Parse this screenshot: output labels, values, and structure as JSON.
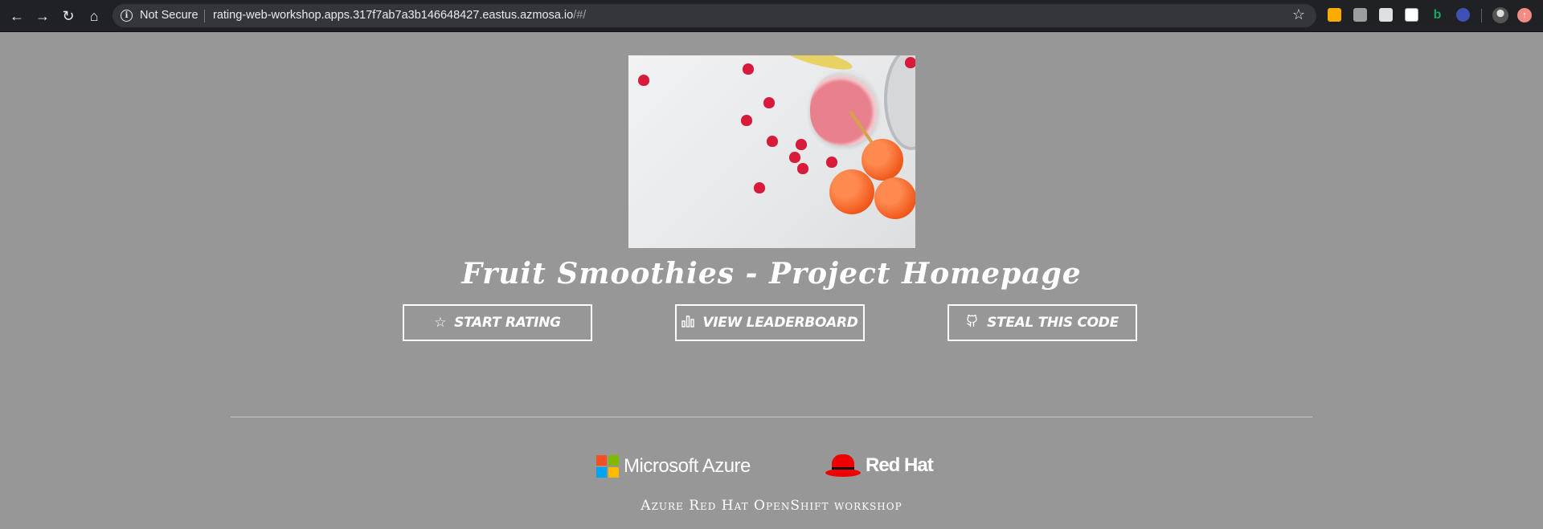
{
  "browser": {
    "security_label": "Not Secure",
    "url_host": "rating-web-workshop.apps.317f7ab7a3b146648427.eastus.azmosa.io",
    "url_path": "/#/",
    "extension_colors": [
      "#f9ab00",
      "#9e9e9e",
      "#ffffff",
      "#ffffff",
      "#1da462",
      "#3f51b5"
    ]
  },
  "page": {
    "title": "Fruit Smoothies - Project Homepage",
    "buttons": {
      "start_rating": {
        "label": "Start Rating",
        "icon": "star-icon"
      },
      "view_leaderboard": {
        "label": "View Leaderboard",
        "icon": "bar-chart-icon"
      },
      "steal_code": {
        "label": "Steal this code",
        "icon": "github-icon"
      }
    },
    "footer": {
      "microsoft_label": "Microsoft Azure",
      "redhat_label": "Red Hat",
      "caption": "Azure Red Hat OpenShift workshop"
    }
  },
  "colors": {
    "page_background": "#979797",
    "chrome_background": "#202124",
    "redhat_red": "#ee0000"
  }
}
